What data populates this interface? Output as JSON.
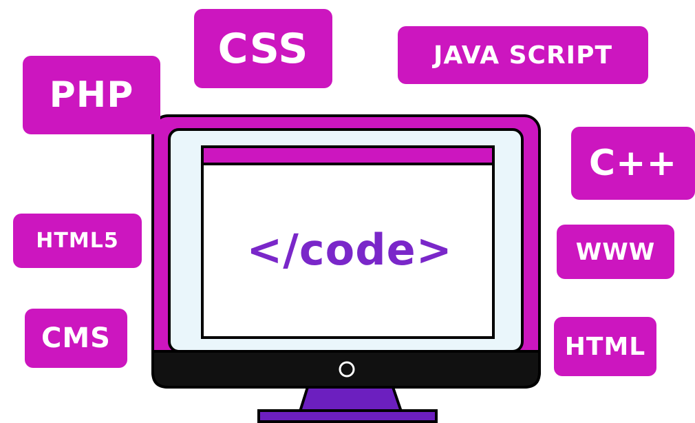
{
  "tags": {
    "css": "CSS",
    "javascript": "JAVA SCRIPT",
    "php": "PHP",
    "cpp": "C++",
    "html5": "HTML5",
    "www": "WWW",
    "cms": "CMS",
    "html": "HTML"
  },
  "screen": {
    "code_text": "</code>"
  },
  "colors": {
    "tag_background": "#cc16bf",
    "tag_text": "#ffffff",
    "monitor_frame": "#cc16bf",
    "monitor_inner": "#eaf6fb",
    "code_text": "#7a27c9",
    "stand": "#6c1fbf"
  },
  "icons": {
    "power": "power-button-icon"
  }
}
